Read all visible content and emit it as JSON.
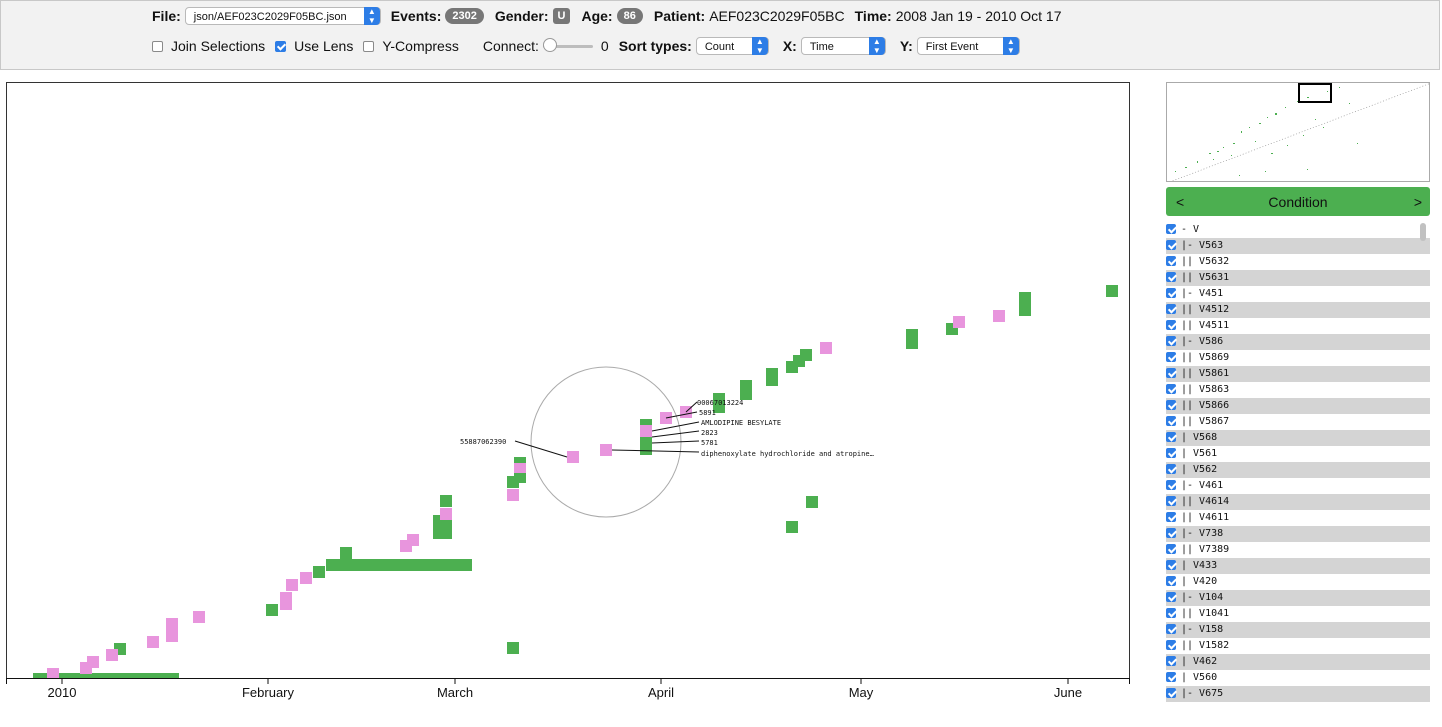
{
  "toolbar": {
    "file_label": "File:",
    "file_value": "json/AEF023C2029F05BC.json",
    "events_label": "Events:",
    "events_value": "2302",
    "gender_label": "Gender:",
    "gender_value": "U",
    "age_label": "Age:",
    "age_value": "86",
    "patient_label": "Patient:",
    "patient_value": "AEF023C2029F05BC",
    "time_label": "Time:",
    "time_value": "2008 Jan 19 - 2010 Oct 17",
    "join_selections_label": "Join Selections",
    "join_selections_checked": false,
    "use_lens_label": "Use Lens",
    "use_lens_checked": true,
    "y_compress_label": "Y-Compress",
    "y_compress_checked": false,
    "connect_label": "Connect:",
    "connect_value": "0",
    "sort_types_label": "Sort types:",
    "sort_types_value": "Count",
    "x_label": "X:",
    "x_value": "Time",
    "y_label": "Y:",
    "y_value": "First Event"
  },
  "colors": {
    "green": "#4caf50",
    "pink": "#e895dd",
    "accent": "#2d7de6"
  },
  "axis": {
    "ticks": [
      "2010",
      "February",
      "March",
      "April",
      "May",
      "June"
    ]
  },
  "lens": {
    "labels": [
      "00067013224",
      "5891",
      "AMLODIPINE BESYLATE",
      "2823",
      "5781",
      "diphenoxylate hydrochloride and atropine…",
      "55887062390"
    ]
  },
  "condition_panel": {
    "title": "Condition",
    "prev": "<",
    "next": ">",
    "items": [
      {
        "label": "- V",
        "checked": true
      },
      {
        "label": "|- V563",
        "checked": true
      },
      {
        "label": "|| V5632",
        "checked": true
      },
      {
        "label": "|| V5631",
        "checked": true
      },
      {
        "label": "|- V451",
        "checked": true
      },
      {
        "label": "|| V4512",
        "checked": true
      },
      {
        "label": "|| V4511",
        "checked": true
      },
      {
        "label": "|- V586",
        "checked": true
      },
      {
        "label": "|| V5869",
        "checked": true
      },
      {
        "label": "|| V5861",
        "checked": true
      },
      {
        "label": "|| V5863",
        "checked": true
      },
      {
        "label": "|| V5866",
        "checked": true
      },
      {
        "label": "|| V5867",
        "checked": true
      },
      {
        "label": "| V568",
        "checked": true
      },
      {
        "label": "| V561",
        "checked": true
      },
      {
        "label": "| V562",
        "checked": true
      },
      {
        "label": "|- V461",
        "checked": true
      },
      {
        "label": "|| V4614",
        "checked": true
      },
      {
        "label": "|| V4611",
        "checked": true
      },
      {
        "label": "|- V738",
        "checked": true
      },
      {
        "label": "|| V7389",
        "checked": true
      },
      {
        "label": "| V433",
        "checked": true
      },
      {
        "label": "| V420",
        "checked": true
      },
      {
        "label": "|- V104",
        "checked": true
      },
      {
        "label": "|| V1041",
        "checked": true
      },
      {
        "label": "|- V158",
        "checked": true
      },
      {
        "label": "|| V1582",
        "checked": true
      },
      {
        "label": "| V462",
        "checked": true
      },
      {
        "label": "| V560",
        "checked": true
      },
      {
        "label": "|- V675",
        "checked": true
      }
    ]
  }
}
